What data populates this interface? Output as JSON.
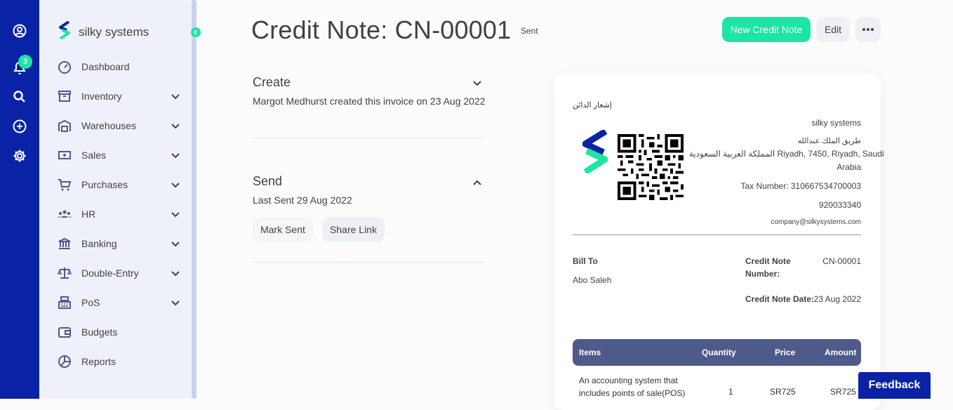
{
  "rail": {
    "notification_count": "3"
  },
  "brand": {
    "name": "silky systems"
  },
  "nav": [
    {
      "label": "Dashboard",
      "icon": "dashboard-icon",
      "expandable": false
    },
    {
      "label": "Inventory",
      "icon": "inventory-icon",
      "expandable": true
    },
    {
      "label": "Warehouses",
      "icon": "warehouse-icon",
      "expandable": true
    },
    {
      "label": "Sales",
      "icon": "sales-icon",
      "expandable": true
    },
    {
      "label": "Purchases",
      "icon": "cart-icon",
      "expandable": true
    },
    {
      "label": "HR",
      "icon": "people-icon",
      "expandable": true
    },
    {
      "label": "Banking",
      "icon": "bank-icon",
      "expandable": true
    },
    {
      "label": "Double-Entry",
      "icon": "scale-icon",
      "expandable": true
    },
    {
      "label": "PoS",
      "icon": "cash-register-icon",
      "expandable": true
    },
    {
      "label": "Budgets",
      "icon": "wallet-icon",
      "expandable": false
    },
    {
      "label": "Reports",
      "icon": "pie-chart-icon",
      "expandable": false
    }
  ],
  "header": {
    "title": "Credit Note: CN-00001",
    "status": "Sent",
    "new_button": "New Credit Note",
    "edit_button": "Edit"
  },
  "create": {
    "heading": "Create",
    "text": "Margot Medhurst created this invoice on 23 Aug 2022"
  },
  "send": {
    "heading": "Send",
    "text": "Last Sent 29 Aug 2022",
    "mark_sent": "Mark Sent",
    "share_link": "Share Link"
  },
  "document": {
    "arabic_title": "إشعار الدائن",
    "company": "silky systems",
    "address_ar": "طريق الملك عبدالله",
    "address_line": "المملكة العربية السعودية Riyadh, 7450, Riyadh, Saudi",
    "address_line2": "Arabia",
    "tax": "Tax Number: 310667534700003",
    "phone": "920033340",
    "email": "company@silkysystems.com",
    "bill_to_label": "Bill To",
    "bill_to_name": "Abo Saleh",
    "number_label_1": "Credit Note",
    "number_label_2": "Number:",
    "number_value": "CN-00001",
    "date_label": "Credit Note Date:",
    "date_value": "23 Aug 2022",
    "columns": {
      "items": "Items",
      "quantity": "Quantity",
      "price": "Price",
      "amount": "Amount"
    },
    "row": {
      "desc_1": "An accounting system that",
      "desc_2": "includes points of sale(POS)",
      "quantity": "1",
      "price": "SR725",
      "amount": "SR725"
    }
  },
  "feedback": "Feedback",
  "colors": {
    "rail": "#0a23a6",
    "accent": "#1de5a3",
    "sidebar": "#eef1fa",
    "table_header": "#4e5a8a"
  }
}
